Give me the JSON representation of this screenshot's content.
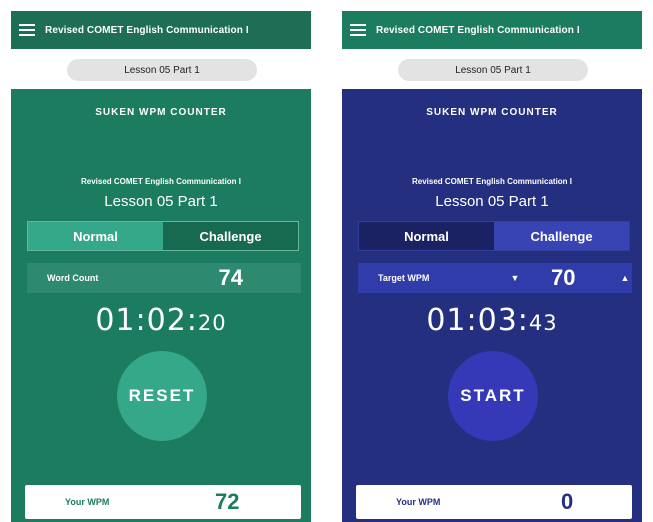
{
  "left_screen": {
    "app_title": "Revised COMET English Communication I",
    "lesson_tab": "Lesson 05 Part 1",
    "counter_title": "SUKEN WPM COUNTER",
    "subtitle": "Revised COMET English Communication I",
    "lesson": "Lesson 05 Part 1",
    "mode_normal": "Normal",
    "mode_challenge": "Challenge",
    "active_mode": "Normal",
    "stat_label": "Word Count",
    "stat_value": "74",
    "timer_main": "01:02:",
    "timer_sec": "20",
    "button_label": "RESET",
    "wpm_label": "Your WPM",
    "wpm_value": "72",
    "bg_color": "#1b7c5f"
  },
  "right_screen": {
    "app_title": "Revised COMET English Communication I",
    "lesson_tab": "Lesson 05 Part 1",
    "counter_title": "SUKEN WPM COUNTER",
    "subtitle": "Revised COMET English Communication I",
    "lesson": "Lesson 05 Part 1",
    "mode_normal": "Normal",
    "mode_challenge": "Challenge",
    "active_mode": "Challenge",
    "stat_label": "Target WPM",
    "stat_value": "70",
    "down_arrow": "▼",
    "up_arrow": "▲",
    "timer_main": "01:03:",
    "timer_sec": "43",
    "button_label": "START",
    "wpm_label": "Your WPM",
    "wpm_value": "0",
    "bg_color": "#252f80"
  }
}
